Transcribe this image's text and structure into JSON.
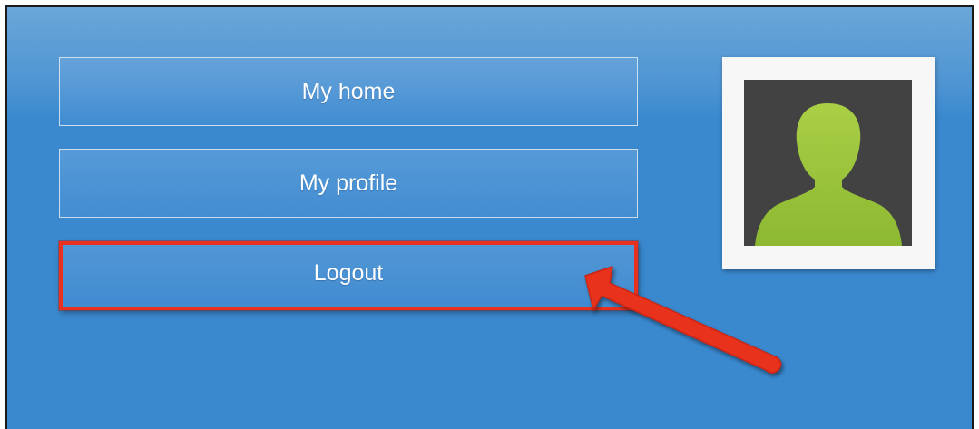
{
  "menu": {
    "items": [
      {
        "label": "My home"
      },
      {
        "label": "My profile"
      },
      {
        "label": "Logout"
      }
    ]
  },
  "highlight": {
    "target": "Logout",
    "color": "#e8321f"
  },
  "avatar": {
    "icon": "user-silhouette-icon",
    "background_color": "#424242",
    "figure_color": "#9cc43a"
  },
  "colors": {
    "panel_blue": "#3a89cf"
  }
}
